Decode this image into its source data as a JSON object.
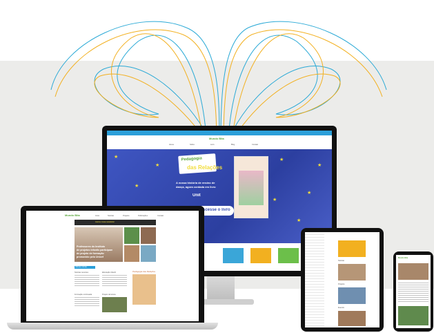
{
  "colors": {
    "band": "#ececea",
    "curve_blue": "#2aa9d6",
    "curve_orange": "#f2b020",
    "brand_green": "#5aa63c",
    "banner_blue": "#3a4fb0"
  },
  "desktop": {
    "logo": "Mundo Bita",
    "nav_links": [
      "Home",
      "Sobre",
      "Livro",
      "Blog",
      "Contato"
    ],
    "hero_title_1": "Pedagogia",
    "hero_title_2": "das Relações",
    "hero_text_1": "A nossa história de ensino de",
    "hero_text_2": "dança, agora contada em livro",
    "hero_logo": "Unit",
    "cta": "Acesse o livro"
  },
  "laptop": {
    "logo": "Mundo Bita",
    "nav_links": [
      "Início",
      "Notícias",
      "Projetos",
      "Publicações",
      "Contato"
    ],
    "banner": "Assine nossa newsletter",
    "headline_1": "Professores do Instituto",
    "headline_2": "de projetos infantis participam",
    "headline_3": "de projeto de formação",
    "headline_4": "promovido pelo Unicef",
    "section_label": "Últimas notícias",
    "card_titles": [
      "Notícias recentes",
      "Educação infantil",
      "Formação continuada",
      "Projeto de leitura"
    ],
    "side_title": "Pedagogia das Relações"
  },
  "tablet": {
    "card_titles": [
      "Notícias",
      "Projetos",
      "Eventos"
    ]
  },
  "phone": {
    "logo": "Mundo Bita"
  }
}
